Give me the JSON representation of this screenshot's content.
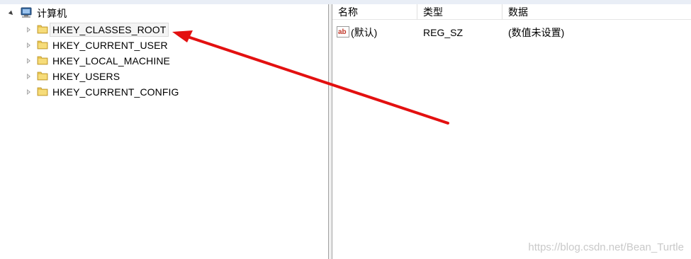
{
  "tree": {
    "root_label": "计算机",
    "items": [
      {
        "label": "HKEY_CLASSES_ROOT"
      },
      {
        "label": "HKEY_CURRENT_USER"
      },
      {
        "label": "HKEY_LOCAL_MACHINE"
      },
      {
        "label": "HKEY_USERS"
      },
      {
        "label": "HKEY_CURRENT_CONFIG"
      }
    ]
  },
  "list": {
    "columns": [
      "名称",
      "类型",
      "数据"
    ],
    "rows": [
      {
        "name": "(默认)",
        "type": "REG_SZ",
        "data": "(数值未设置)"
      }
    ]
  },
  "watermark": "https://blog.csdn.net/Bean_Turtle",
  "colors": {
    "annotation_arrow": "#e31010",
    "selection_bg": "#f4f4f4",
    "splitter": "#f0f0f0"
  }
}
